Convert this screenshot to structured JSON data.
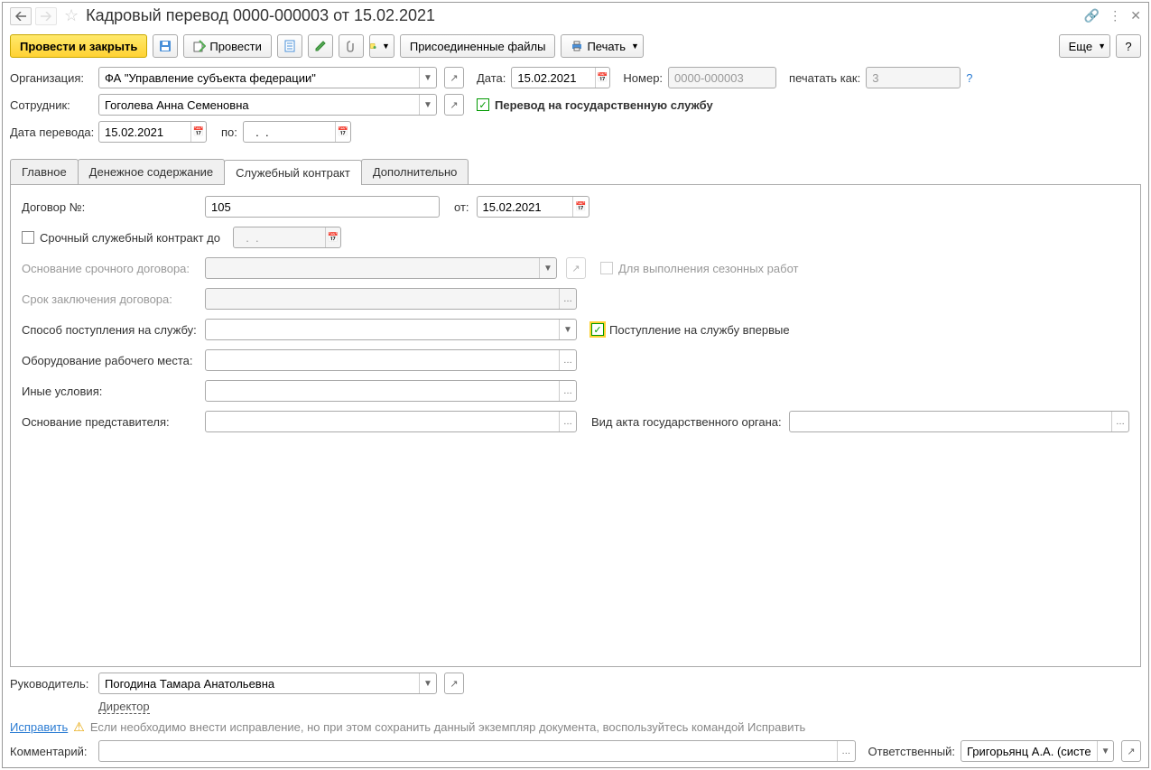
{
  "title": "Кадровый перевод 0000-000003 от 15.02.2021",
  "toolbar": {
    "approve_close": "Провести и закрыть",
    "approve": "Провести",
    "attached_files": "Присоединенные файлы",
    "print": "Печать",
    "more": "Еще",
    "help": "?"
  },
  "fields": {
    "org_label": "Организация:",
    "org_value": "ФА \"Управление субъекта федерации\"",
    "date_label": "Дата:",
    "date_value": "15.02.2021",
    "number_label": "Номер:",
    "number_value": "0000-000003",
    "print_as_label": "печатать как:",
    "print_as_value": "3",
    "employee_label": "Сотрудник:",
    "employee_value": "Гоголева Анна Семеновна",
    "transfer_gov": "Перевод на государственную службу",
    "transfer_date_label": "Дата перевода:",
    "transfer_date_value": "15.02.2021",
    "to_label": "по:",
    "to_value": "  .  .    "
  },
  "tabs": {
    "main": "Главное",
    "payment": "Денежное содержание",
    "contract": "Служебный контракт",
    "extra": "Дополнительно"
  },
  "contract": {
    "contract_no_label": "Договор №:",
    "contract_no_value": "105",
    "from_label": "от:",
    "from_value": "15.02.2021",
    "urgent_label": "Срочный служебный контракт до",
    "urgent_value": "  .  .    ",
    "urgent_basis_label": "Основание срочного договора:",
    "seasonal_label": "Для выполнения сезонных работ",
    "term_label": "Срок заключения договора:",
    "entry_method_label": "Способ поступления на службу:",
    "first_entry_label": "Поступление на службу впервые",
    "equipment_label": "Оборудование рабочего места:",
    "other_cond_label": "Иные условия:",
    "rep_basis_label": "Основание представителя:",
    "act_type_label": "Вид акта государственного органа:"
  },
  "footer": {
    "manager_label": "Руководитель:",
    "manager_value": "Погодина Тамара Анатольевна",
    "manager_role": "Директор",
    "fix_link": "Исправить",
    "fix_hint": "Если необходимо внести исправление, но при этом сохранить данный экземпляр документа, воспользуйтесь командой Исправить",
    "comment_label": "Комментарий:",
    "responsible_label": "Ответственный:",
    "responsible_value": "Григорьянц А.А. (системн"
  }
}
